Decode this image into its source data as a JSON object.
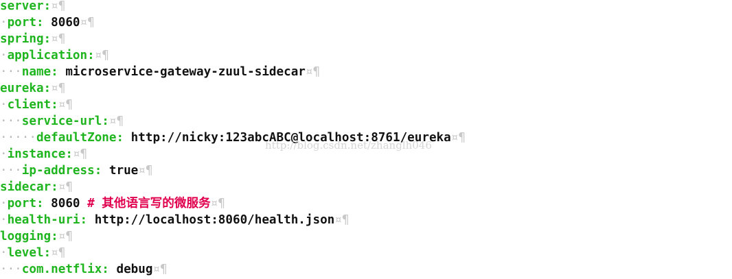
{
  "editor": {
    "markers": {
      "space": "·",
      "tab": "¤",
      "pilcrow": "¶"
    },
    "lines": [
      {
        "indent": "",
        "key": "server:",
        "value": "",
        "comment": "",
        "tail": "¤¶"
      },
      {
        "indent": "·",
        "key": "port:",
        "value": "8060",
        "comment": "",
        "tail": "¤¶"
      },
      {
        "indent": "",
        "key": "spring:",
        "value": "",
        "comment": "",
        "tail": "¤¶"
      },
      {
        "indent": "·",
        "key": "application:",
        "value": "",
        "comment": "",
        "tail": "¤¶"
      },
      {
        "indent": "···",
        "key": "name:",
        "value": "microservice-gateway-zuul-sidecar",
        "comment": "",
        "tail": "¤¶"
      },
      {
        "indent": "",
        "key": "eureka:",
        "value": "",
        "comment": "",
        "tail": "¤¶"
      },
      {
        "indent": "·",
        "key": "client:",
        "value": "",
        "comment": "",
        "tail": "¤¶"
      },
      {
        "indent": "···",
        "key": "service-url:",
        "value": "",
        "comment": "",
        "tail": "¤¶"
      },
      {
        "indent": "·····",
        "key": "defaultZone:",
        "value": "http://nicky:123abcABC@localhost:8761/eureka",
        "comment": "",
        "tail": "¤¶"
      },
      {
        "indent": "·",
        "key": "instance:",
        "value": "",
        "comment": "",
        "tail": "¤¶"
      },
      {
        "indent": "···",
        "key": "ip-address:",
        "value": "true",
        "comment": "",
        "tail": "¤¶"
      },
      {
        "indent": "",
        "key": "sidecar:",
        "value": "",
        "comment": "",
        "tail": "¤¶"
      },
      {
        "indent": "·",
        "key": "port:",
        "value": "8060",
        "comment": "# 其他语言写的微服务",
        "tail": "¤¶"
      },
      {
        "indent": "·",
        "key": "health-uri:",
        "value": "http://localhost:8060/health.json",
        "comment": "",
        "tail": "¤¶"
      },
      {
        "indent": "",
        "key": "logging:",
        "value": "",
        "comment": "",
        "tail": "¤¶"
      },
      {
        "indent": "·",
        "key": "level:",
        "value": "",
        "comment": "",
        "tail": "¤¶"
      },
      {
        "indent": "···",
        "key": "com.netflix:",
        "value": "debug",
        "comment": "",
        "tail": "¤¶"
      }
    ]
  },
  "watermark": "http://blog.csdn.net/zhanglh046",
  "colors": {
    "key": "#1fb51f",
    "value": "#111111",
    "comment": "#e0004d",
    "whitespace_marker": "#b8b8b8"
  }
}
